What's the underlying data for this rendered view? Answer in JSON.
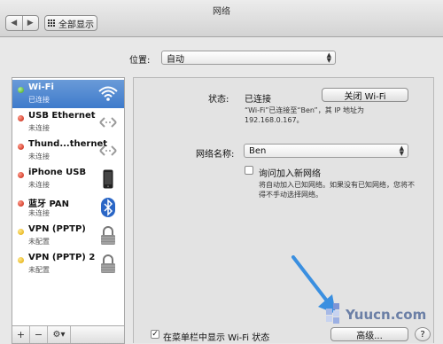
{
  "window": {
    "title": "网络",
    "nav_back": "◀",
    "nav_forward": "▶",
    "show_all": "全部显示"
  },
  "location": {
    "label": "位置:",
    "value": "自动"
  },
  "services": [
    {
      "name": "Wi-Fi",
      "status": "已连接",
      "dot": "green",
      "icon": "wifi-icon",
      "selected": true
    },
    {
      "name": "USB Ethernet",
      "status": "未连接",
      "dot": "red",
      "icon": "ethernet-arrows-icon"
    },
    {
      "name": "Thund...thernet",
      "status": "未连接",
      "dot": "red",
      "icon": "ethernet-arrows-icon"
    },
    {
      "name": "iPhone USB",
      "status": "未连接",
      "dot": "red",
      "icon": "iphone-icon"
    },
    {
      "name": "蓝牙 PAN",
      "status": "未连接",
      "dot": "red",
      "icon": "bluetooth-icon"
    },
    {
      "name": "VPN (PPTP)",
      "status": "未配置",
      "dot": "yellow",
      "icon": "lock-icon"
    },
    {
      "name": "VPN (PPTP) 2",
      "status": "未配置",
      "dot": "yellow",
      "icon": "lock-icon"
    }
  ],
  "sidebar_tools": {
    "add": "+",
    "remove": "−",
    "action": "⚙▾"
  },
  "detail": {
    "status_label": "状态:",
    "status_value": "已连接",
    "toggle_wifi": "关闭 Wi-Fi",
    "status_desc_line1": "“Wi-Fi”已连接至“Ben”，其 IP 地址为",
    "status_desc_line2": "192.168.0.167。",
    "network_name_label": "网络名称:",
    "network_name_value": "Ben",
    "ask_join_label": "询问加入新网络",
    "ask_join_desc_line1": "将自动加入已知网络。如果没有已知网络，您将不",
    "ask_join_desc_line2": "得不手动选择网络。",
    "show_in_menubar_label": "在菜单栏中显示 Wi-Fi 状态",
    "show_in_menubar_checked": true,
    "advanced": "高级...",
    "help": "?"
  },
  "watermark": {
    "text": "Yuucn.com"
  },
  "colors": {
    "selection": "#3e7bcb",
    "accent_arrow": "#3a8fe0"
  }
}
